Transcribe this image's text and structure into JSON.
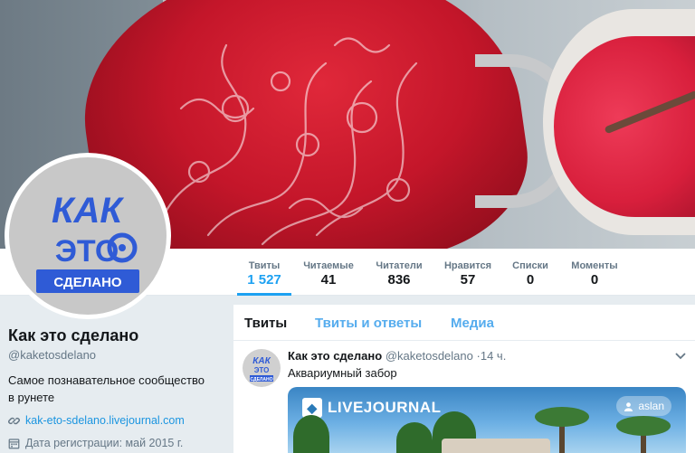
{
  "profile": {
    "avatar_text_1": "КАК",
    "avatar_text_2": "ЭТО",
    "avatar_text_3": "СДЕЛАНО",
    "name": "Как это сделано",
    "handle": "@kaketosdelano",
    "bio": "Самое познавательное сообщество в рунете",
    "link": "kak-eto-sdelano.livejournal.com",
    "join_date": "Дата регистрации: май 2015 г.",
    "link_icon": "link-icon",
    "date_icon": "calendar-icon"
  },
  "nav": {
    "items": [
      {
        "label": "Твиты",
        "value": "1 527",
        "active": true
      },
      {
        "label": "Читаемые",
        "value": "41"
      },
      {
        "label": "Читатели",
        "value": "836"
      },
      {
        "label": "Нравится",
        "value": "57"
      },
      {
        "label": "Списки",
        "value": "0"
      },
      {
        "label": "Моменты",
        "value": "0"
      }
    ]
  },
  "timeline": {
    "tabs": [
      "Твиты",
      "Твиты и ответы",
      "Медиа"
    ],
    "tweet": {
      "name": "Как это сделано",
      "handle": "@kaketosdelano",
      "sep": "·",
      "time": "14 ч.",
      "text": "Аквариумный забор",
      "card": {
        "brand": "LIVEJOURNAL",
        "user": "aslan"
      }
    }
  },
  "colors": {
    "accent": "#1da1f2",
    "avatar_blue": "#2f5bd6",
    "page_bg": "#e6ecf0"
  }
}
